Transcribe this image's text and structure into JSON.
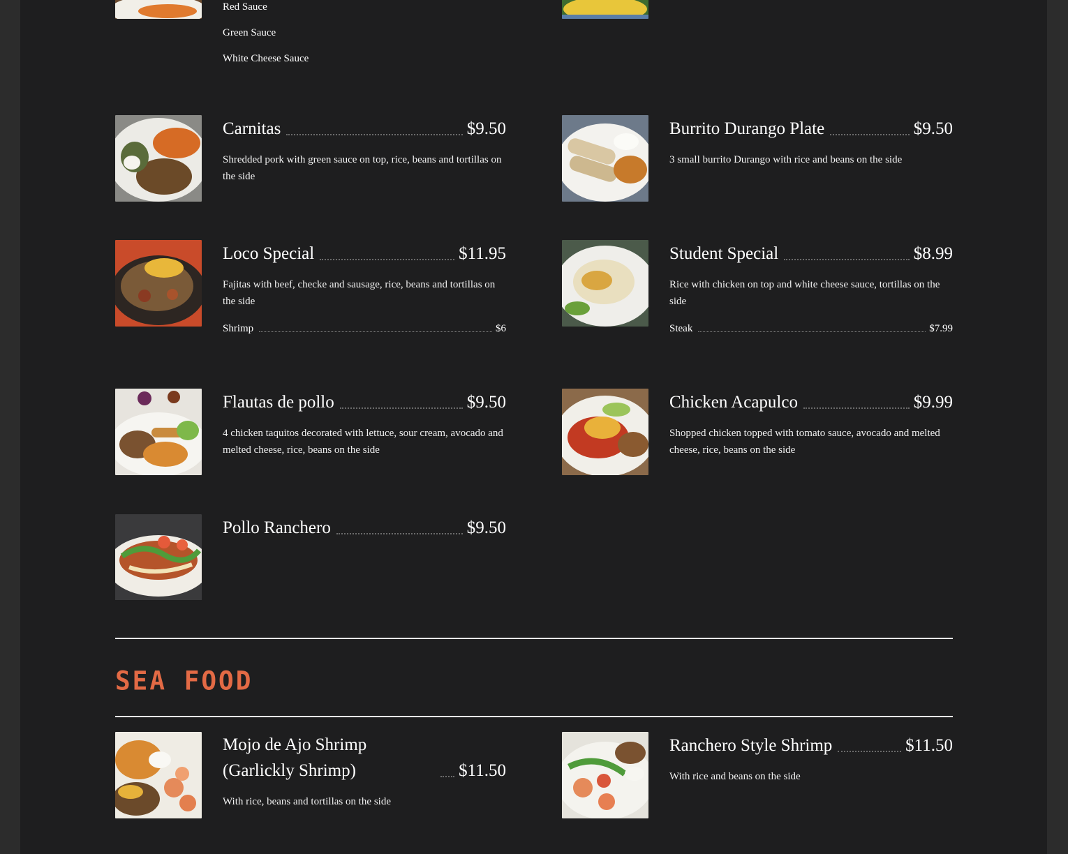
{
  "sauces": [
    "Red Sauce",
    "Green Sauce",
    "White Cheese Sauce"
  ],
  "items": [
    {
      "title": "Carnitas",
      "price": "$9.50",
      "desc": "Shredded pork with green sauce on top, rice, beans and tortillas on the side"
    },
    {
      "title": "Burrito Durango Plate",
      "price": "$9.50",
      "desc": "3 small burrito Durango with rice and beans on the side"
    },
    {
      "title": "Loco Special",
      "price": "$11.95",
      "desc": "Fajitas with beef, checke and sausage, rice, beans and tortillas on the side",
      "option": {
        "label": "Shrimp",
        "price": "$6"
      }
    },
    {
      "title": "Student Special",
      "price": "$8.99",
      "desc": "Rice with chicken on top and white cheese sauce, tortillas on the side",
      "option": {
        "label": "Steak",
        "price": "$7.99"
      }
    },
    {
      "title": "Flautas de pollo",
      "price": "$9.50",
      "desc": "4 chicken taquitos decorated with lettuce, sour cream, avocado and melted cheese, rice, beans on the side"
    },
    {
      "title": "Chicken Acapulco",
      "price": "$9.99",
      "desc": "Shopped chicken topped with tomato sauce, avocado and melted cheese, rice, beans on the side"
    },
    {
      "title": "Pollo Ranchero",
      "price": "$9.50",
      "desc": ""
    }
  ],
  "seafood": {
    "heading": "SEA FOOD",
    "items": [
      {
        "title": "Mojo de Ajo Shrimp (Garlickly Shrimp)",
        "price": "$11.50",
        "desc": "With rice, beans and tortillas on the side"
      },
      {
        "title": "Ranchero Style Shrimp",
        "price": "$11.50",
        "desc": "With rice and beans on the side"
      }
    ]
  },
  "colors": {
    "background": "#1e1e1f",
    "accent": "#e36a45",
    "text": "#ffffff"
  }
}
